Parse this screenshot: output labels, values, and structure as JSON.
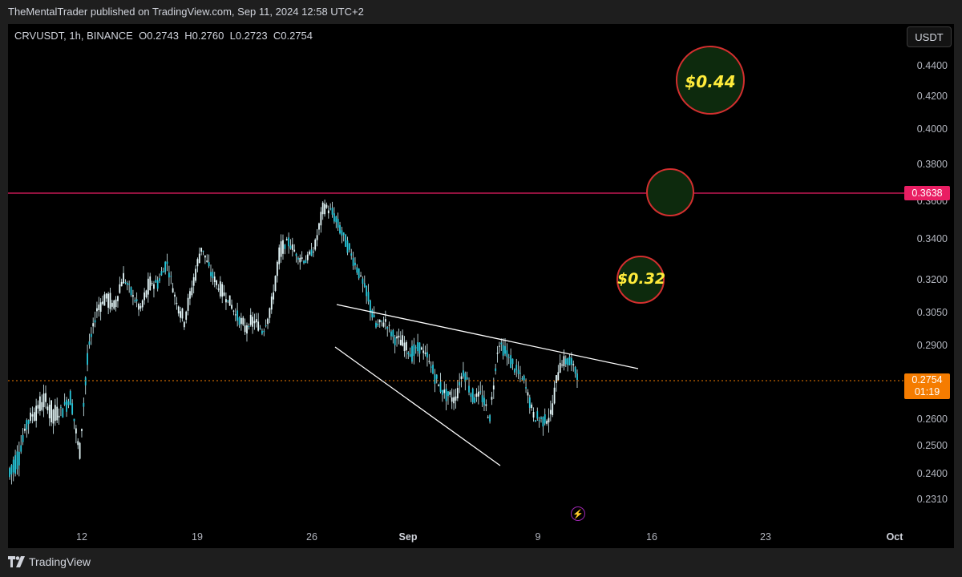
{
  "header": {
    "text": "TheMentalTrader published on TradingView.com, Sep 11, 2024 12:58 UTC+2"
  },
  "legend": {
    "symbol": "CRVUSDT, 1h, BINANCE",
    "o_label": "O",
    "o_value": "0.2743",
    "h_label": "H",
    "h_value": "0.2760",
    "l_label": "L",
    "l_value": "0.2723",
    "c_label": "C",
    "c_value": "0.2754"
  },
  "currency_button": "USDT",
  "price_axis": [
    "0.4400",
    "0.4200",
    "0.4000",
    "0.3800",
    "0.3600",
    "0.3400",
    "0.3200",
    "0.3050",
    "0.2900",
    "0.2750",
    "0.2600",
    "0.2500",
    "0.2400",
    "0.2310"
  ],
  "time_axis": [
    {
      "label": "12",
      "bold": false
    },
    {
      "label": "19",
      "bold": false
    },
    {
      "label": "26",
      "bold": false
    },
    {
      "label": "Sep",
      "bold": true
    },
    {
      "label": "9",
      "bold": false
    },
    {
      "label": "16",
      "bold": false
    },
    {
      "label": "23",
      "bold": false
    },
    {
      "label": "Oct",
      "bold": true
    }
  ],
  "resistance_level": {
    "value": "0.3638",
    "color": "#e91e63"
  },
  "current_price": {
    "value": "0.2754",
    "countdown": "01:19",
    "color": "#f57c00"
  },
  "targets": [
    {
      "label": "$0.44",
      "price": 0.4315
    },
    {
      "label": "",
      "price": 0.3638
    },
    {
      "label": "$0.32",
      "price": 0.32
    }
  ],
  "footer": {
    "brand": "TradingView"
  },
  "icons": {
    "logo": "tradingview-logo-icon",
    "flash": "lightning-icon"
  },
  "chart_data": {
    "type": "candlestick",
    "symbol": "CRVUSDT",
    "interval": "1h",
    "price_range": [
      0.227,
      0.452
    ],
    "close_path": [
      [
        0.242,
        0.235
      ],
      [
        0.248,
        0.24
      ],
      [
        0.26,
        0.255
      ],
      [
        0.261,
        0.27
      ],
      [
        0.266,
        0.272
      ],
      [
        0.258,
        0.27
      ],
      [
        0.265,
        0.26
      ],
      [
        0.27,
        0.265
      ],
      [
        0.245,
        0.25
      ],
      [
        0.29,
        0.28
      ],
      [
        0.305,
        0.31
      ],
      [
        0.31,
        0.318
      ],
      [
        0.305,
        0.315
      ],
      [
        0.32,
        0.325
      ],
      [
        0.315,
        0.31
      ],
      [
        0.305,
        0.31
      ],
      [
        0.315,
        0.325
      ],
      [
        0.32,
        0.315
      ],
      [
        0.33,
        0.325
      ],
      [
        0.31,
        0.315
      ],
      [
        0.3,
        0.305
      ],
      [
        0.315,
        0.325
      ],
      [
        0.335,
        0.34
      ],
      [
        0.325,
        0.32
      ],
      [
        0.315,
        0.32
      ],
      [
        0.31,
        0.315
      ],
      [
        0.305,
        0.3
      ],
      [
        0.295,
        0.305
      ],
      [
        0.3,
        0.305
      ],
      [
        0.297,
        0.295
      ],
      [
        0.305,
        0.315
      ],
      [
        0.33,
        0.345
      ],
      [
        0.34,
        0.335
      ],
      [
        0.33,
        0.335
      ],
      [
        0.33,
        0.328
      ],
      [
        0.335,
        0.34
      ],
      [
        0.355,
        0.365
      ],
      [
        0.355,
        0.35
      ],
      [
        0.345,
        0.34
      ],
      [
        0.335,
        0.33
      ],
      [
        0.325,
        0.32
      ],
      [
        0.315,
        0.305
      ],
      [
        0.3,
        0.295
      ],
      [
        0.3,
        0.305
      ],
      [
        0.295,
        0.29
      ],
      [
        0.29,
        0.295
      ],
      [
        0.288,
        0.282
      ],
      [
        0.29,
        0.288
      ],
      [
        0.285,
        0.28
      ],
      [
        0.275,
        0.272
      ],
      [
        0.27,
        0.268
      ],
      [
        0.265,
        0.275
      ],
      [
        0.28,
        0.278
      ],
      [
        0.27,
        0.265
      ],
      [
        0.27,
        0.268
      ],
      [
        0.26,
        0.262
      ],
      [
        0.29,
        0.295
      ],
      [
        0.288,
        0.28
      ],
      [
        0.28,
        0.278
      ],
      [
        0.276,
        0.27
      ],
      [
        0.262,
        0.26
      ],
      [
        0.26,
        0.258
      ],
      [
        0.26,
        0.265
      ],
      [
        0.28,
        0.288
      ],
      [
        0.285,
        0.28
      ],
      [
        0.28,
        0.2754
      ]
    ]
  }
}
